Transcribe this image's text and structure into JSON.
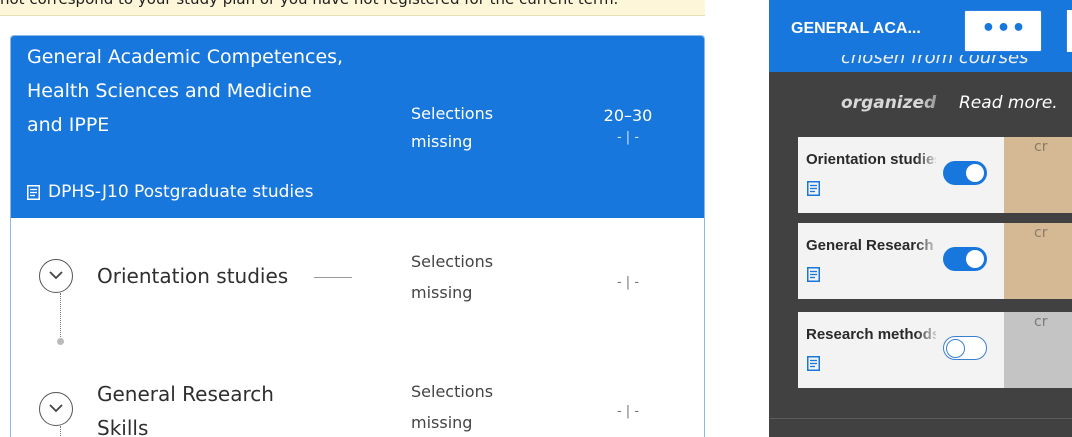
{
  "notice": {
    "text": "not correspond to your study plan or you have not registered for the current term."
  },
  "left": {
    "group": {
      "title": "General Academic Competences, Health Sciences and Medicine and IPPE",
      "code": "DPHS-J10 Postgraduate studies",
      "status": "Selections missing",
      "credits": "20–30",
      "credits_sub": "- | -"
    },
    "rows": [
      {
        "title": "Orientation studies",
        "status": "Selections missing",
        "credits": "- | -"
      },
      {
        "title": "General Research Skills",
        "status": "Selections missing",
        "credits": "- | -"
      }
    ]
  },
  "right": {
    "tab_label": "GENERAL ACA...",
    "more_label": "•••",
    "desc_line1": "chosen from courses",
    "desc_line2": "organized",
    "read_more": "Read more.",
    "courses": [
      {
        "name": "Orientation studies",
        "toggle": "on",
        "credit_label": "cr",
        "credit_color": "#d5b995"
      },
      {
        "name": "General Research Skills",
        "toggle": "on",
        "credit_label": "cr",
        "credit_color": "#d5b995"
      },
      {
        "name": "Research methods",
        "toggle": "off",
        "credit_label": "cr",
        "credit_color": "#c4c4c4"
      }
    ]
  },
  "colors": {
    "primary": "#1877dc",
    "dark_panel": "#414141",
    "notice_bg": "#fdf6d8"
  }
}
